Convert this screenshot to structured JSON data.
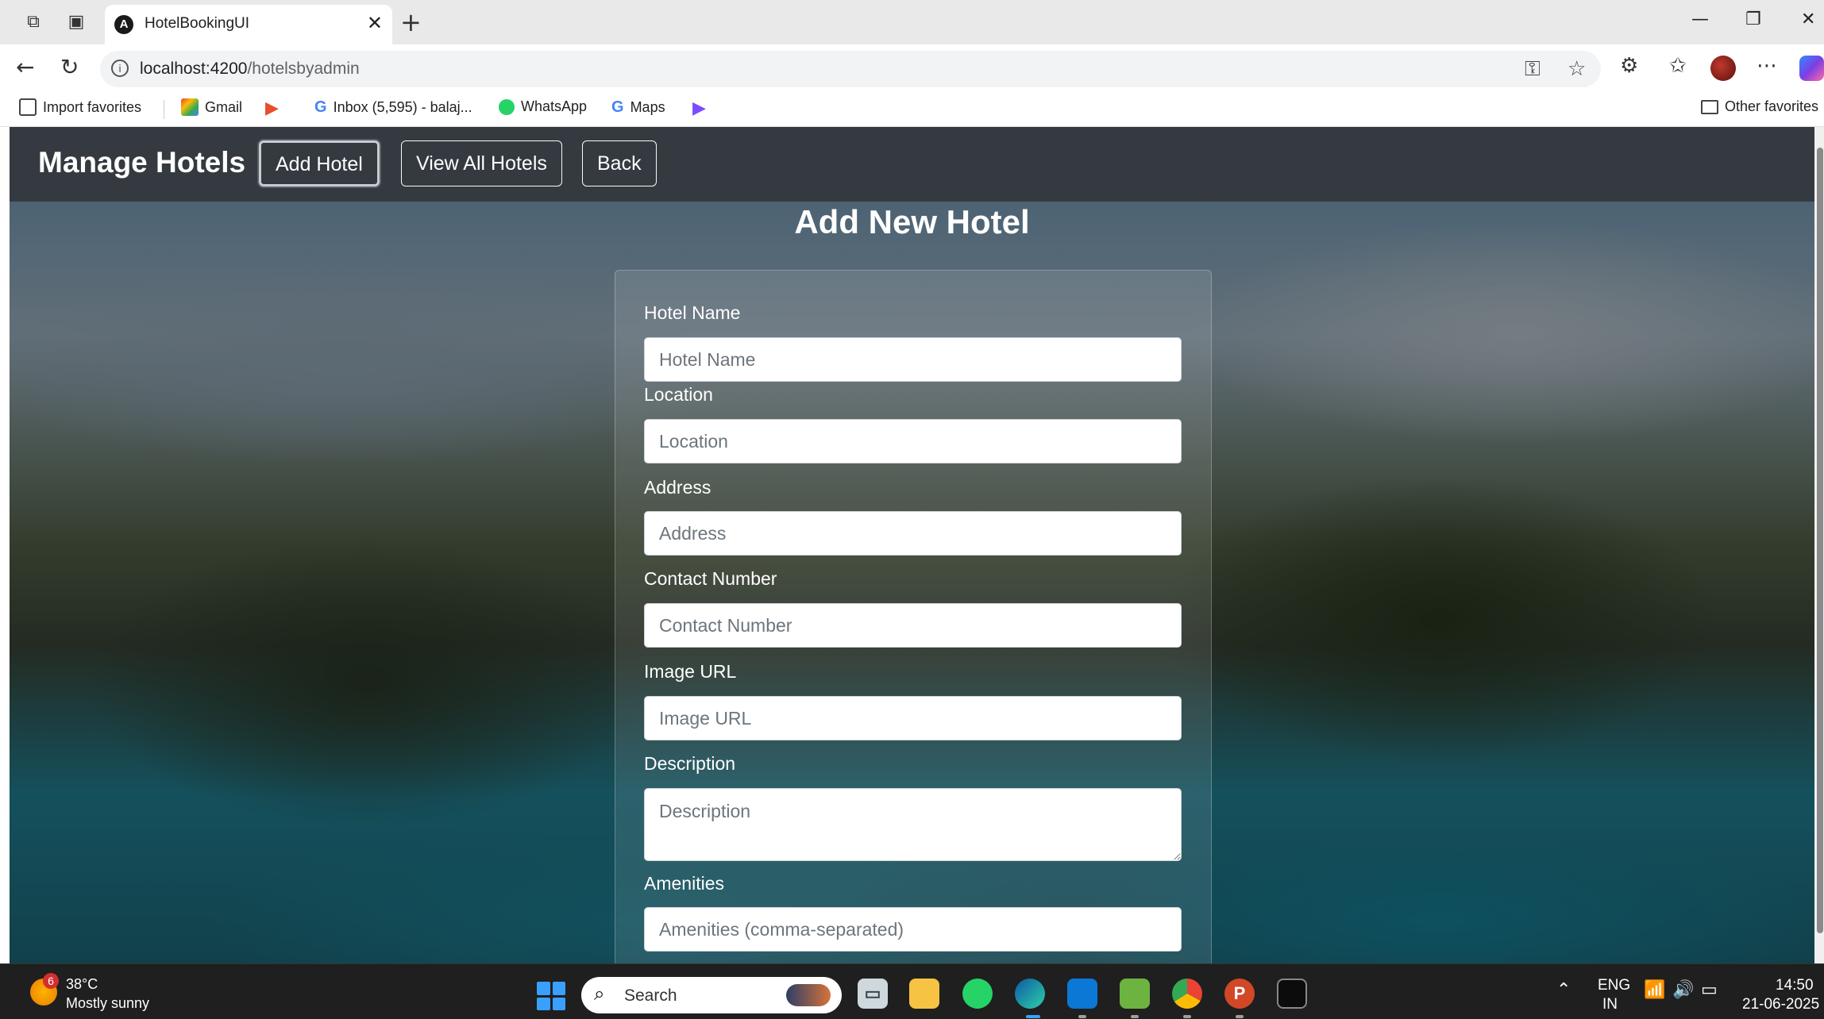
{
  "browser": {
    "tab_title": "HotelBookingUI",
    "tab_favicon": "A",
    "url_host": "localhost:4200",
    "url_path": "/hotelsbyadmin",
    "bookmarks": [
      "Import favorites",
      "Gmail",
      "Inbox (5,595) - balaj...",
      "WhatsApp",
      "Maps"
    ],
    "other_favorites": "Other favorites"
  },
  "app": {
    "brand": "Manage Hotels",
    "nav_buttons": [
      "Add Hotel",
      "View All Hotels",
      "Back"
    ],
    "page_title": "Add New Hotel"
  },
  "form": {
    "fields": [
      {
        "label": "Hotel Name",
        "placeholder": "Hotel Name"
      },
      {
        "label": "Location",
        "placeholder": "Location"
      },
      {
        "label": "Address",
        "placeholder": "Address"
      },
      {
        "label": "Contact Number",
        "placeholder": "Contact Number"
      },
      {
        "label": "Image URL",
        "placeholder": "Image URL"
      },
      {
        "label": "Description",
        "placeholder": "Description"
      },
      {
        "label": "Amenities",
        "placeholder": "Amenities (comma-separated)"
      }
    ]
  },
  "taskbar": {
    "weather_badge": "6",
    "weather_temp": "38°C",
    "weather_desc": "Mostly sunny",
    "search_label": "Search",
    "lang_top": "ENG",
    "lang_bottom": "IN",
    "time": "14:50",
    "date": "21-06-2025"
  },
  "colors": {
    "navbar": "#343a40",
    "accent_blue": "#3aa0ff"
  }
}
